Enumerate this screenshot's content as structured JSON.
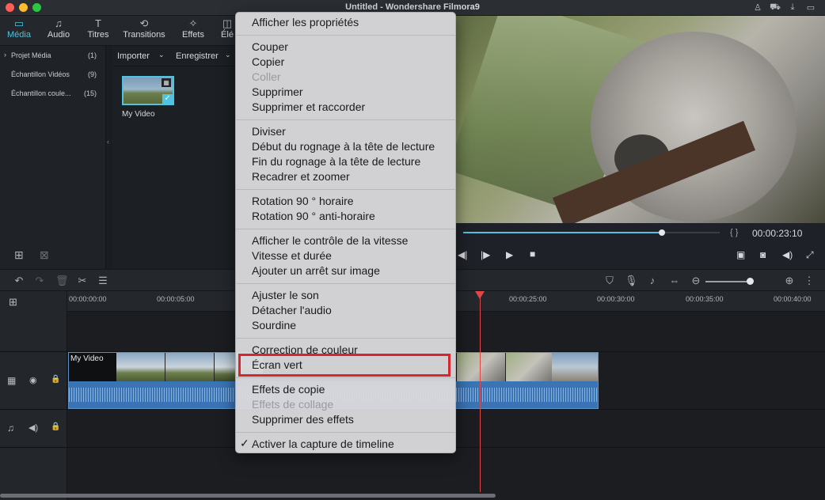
{
  "window": {
    "title": "Untitled - Wondershare Filmora9"
  },
  "tabs": [
    {
      "label": "Média",
      "icon": "folder-icon",
      "active": true
    },
    {
      "label": "Audio",
      "icon": "music-note-icon",
      "active": false
    },
    {
      "label": "Titres",
      "icon": "text-icon",
      "active": false
    },
    {
      "label": "Transitions",
      "icon": "transition-icon",
      "active": false
    },
    {
      "label": "Effets",
      "icon": "effects-icon",
      "active": false
    },
    {
      "label": "Élé",
      "icon": "elements-icon",
      "active": false
    }
  ],
  "library": {
    "items": [
      {
        "label": "Projet Média",
        "count": "(1)"
      },
      {
        "label": "Échantillon Vidéos",
        "count": "(9)"
      },
      {
        "label": "Échantillon coule...",
        "count": "(15)"
      }
    ]
  },
  "media": {
    "import_label": "Importer",
    "record_label": "Enregistrer",
    "item_name": "My Video"
  },
  "preview": {
    "timecode": "00:00:23:10",
    "progress": 0.87
  },
  "ruler": {
    "ticks": [
      "00:00:00:00",
      "00:00:05:00",
      "00:00:25:00",
      "00:00:30:00",
      "00:00:35:00",
      "00:00:40:00"
    ]
  },
  "clip": {
    "name": "My Video"
  },
  "zoom": {
    "level": 0.5
  },
  "menu": {
    "groups": [
      [
        {
          "label": "Afficher les propriétés",
          "enabled": true
        }
      ],
      [
        {
          "label": "Couper",
          "enabled": true
        },
        {
          "label": "Copier",
          "enabled": true
        },
        {
          "label": "Coller",
          "enabled": false
        },
        {
          "label": "Supprimer",
          "enabled": true
        },
        {
          "label": "Supprimer et raccorder",
          "enabled": true
        }
      ],
      [
        {
          "label": "Diviser",
          "enabled": true
        },
        {
          "label": "Début du rognage à la tête de lecture",
          "enabled": true
        },
        {
          "label": "Fin du rognage à la tête de lecture",
          "enabled": true
        },
        {
          "label": "Recadrer et zoomer",
          "enabled": true
        }
      ],
      [
        {
          "label": "Rotation 90 ° horaire",
          "enabled": true
        },
        {
          "label": "Rotation 90 ° anti-horaire",
          "enabled": true
        }
      ],
      [
        {
          "label": "Afficher le contrôle de la vitesse",
          "enabled": true
        },
        {
          "label": "Vitesse et durée",
          "enabled": true
        },
        {
          "label": "Ajouter un arrêt sur image",
          "enabled": true
        }
      ],
      [
        {
          "label": "Ajuster le son",
          "enabled": true
        },
        {
          "label": "Détacher l'audio",
          "enabled": true
        },
        {
          "label": "Sourdine",
          "enabled": true
        }
      ],
      [
        {
          "label": "Correction de couleur",
          "enabled": true
        },
        {
          "label": "Écran vert",
          "enabled": true,
          "highlighted": true
        }
      ],
      [
        {
          "label": "Effets de copie",
          "enabled": true
        },
        {
          "label": "Effets de collage",
          "enabled": false
        },
        {
          "label": "Supprimer des effets",
          "enabled": true
        }
      ],
      [
        {
          "label": "Activer la capture de timeline",
          "enabled": true,
          "checked": true
        }
      ]
    ]
  },
  "colors": {
    "accent": "#4fc3e0",
    "highlight_box": "#d7262d",
    "playhead": "#e04646"
  }
}
